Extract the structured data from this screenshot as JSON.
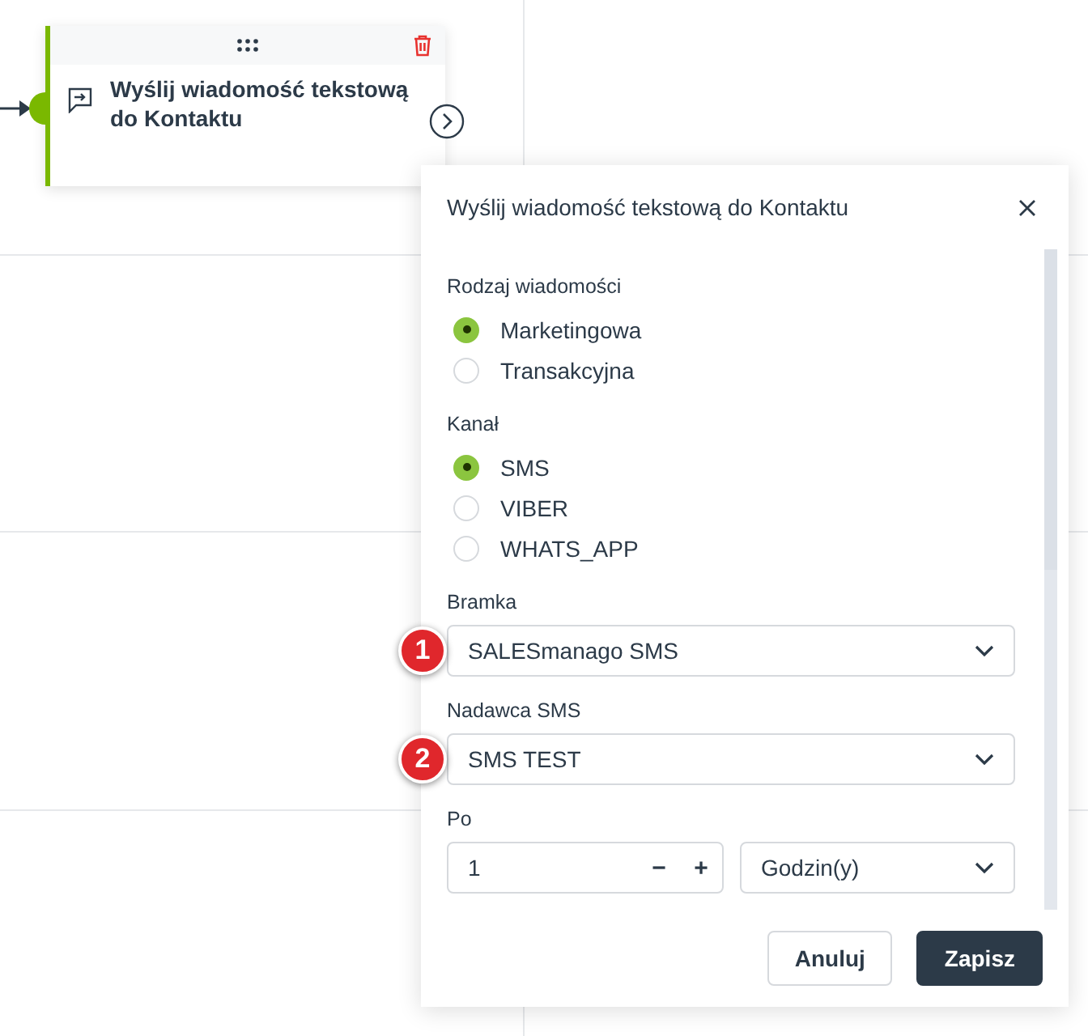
{
  "node": {
    "title": "Wyślij wiadomość tekstową do Kontaktu"
  },
  "panel": {
    "title": "Wyślij wiadomość tekstową do Kontaktu",
    "sections": [
      {
        "kind": "radio",
        "label": "Rodzaj wiadomości",
        "options": [
          {
            "label": "Marketingowa",
            "selected": true
          },
          {
            "label": "Transakcyjna",
            "selected": false
          }
        ]
      },
      {
        "kind": "radio",
        "label": "Kanał",
        "options": [
          {
            "label": "SMS",
            "selected": true
          },
          {
            "label": "VIBER",
            "selected": false
          },
          {
            "label": "WHATS_APP",
            "selected": false
          }
        ]
      },
      {
        "kind": "select",
        "label": "Bramka",
        "value": "SALESmanago SMS",
        "badge": "1"
      },
      {
        "kind": "select",
        "label": "Nadawca SMS",
        "value": "SMS TEST",
        "badge": "2"
      },
      {
        "kind": "delay",
        "label": "Po",
        "value": "1",
        "minus": "−",
        "plus": "+",
        "unit": "Godzin(y)"
      }
    ],
    "buttons": [
      {
        "label": "Anuluj",
        "kind": "secondary"
      },
      {
        "label": "Zapisz",
        "kind": "primary"
      }
    ]
  }
}
